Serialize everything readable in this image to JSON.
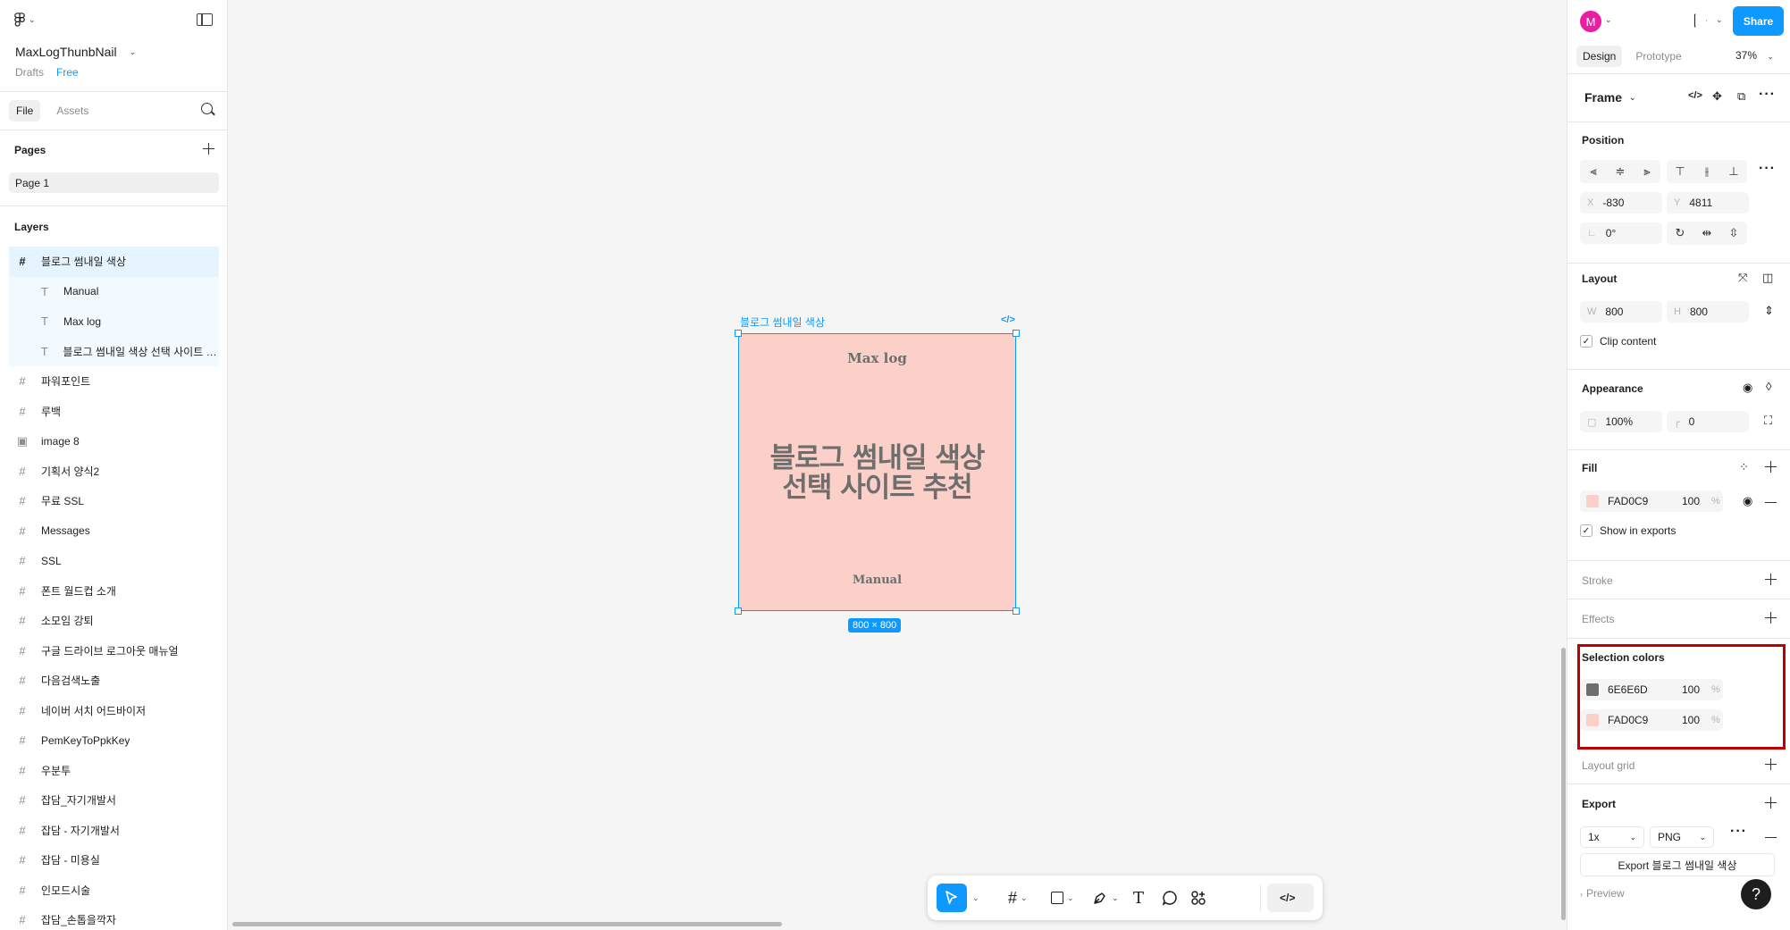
{
  "file": {
    "name": "MaxLogThunbNail",
    "location": "Drafts",
    "plan": "Free"
  },
  "left_tabs": {
    "file": "File",
    "assets": "Assets"
  },
  "pages": {
    "label": "Pages",
    "items": [
      "Page 1"
    ]
  },
  "layers": {
    "label": "Layers",
    "items": [
      {
        "name": "블로그 썸내일 색상",
        "type": "frame",
        "selected": true
      },
      {
        "name": "Manual",
        "type": "text",
        "child": true
      },
      {
        "name": "Max log",
        "type": "text",
        "child": true
      },
      {
        "name": "블로그 썸내일 색상 선택 사이트 추천",
        "type": "text",
        "child": true
      },
      {
        "name": "파워포인트",
        "type": "frame"
      },
      {
        "name": "루백",
        "type": "frame"
      },
      {
        "name": "image 8",
        "type": "image"
      },
      {
        "name": "기획서 양식2",
        "type": "frame"
      },
      {
        "name": "무료 SSL",
        "type": "frame"
      },
      {
        "name": "Messages",
        "type": "frame"
      },
      {
        "name": "SSL",
        "type": "frame"
      },
      {
        "name": "폰트 월드컵 소개",
        "type": "frame"
      },
      {
        "name": "소모임 강퇴",
        "type": "frame"
      },
      {
        "name": "구글 드라이브 로그아웃 매뉴얼",
        "type": "frame"
      },
      {
        "name": "다음검색노출",
        "type": "frame"
      },
      {
        "name": "네이버 서치 어드바이저",
        "type": "frame"
      },
      {
        "name": "PemKeyToPpkKey",
        "type": "frame"
      },
      {
        "name": "우분투",
        "type": "frame"
      },
      {
        "name": "잡담_자기개발서",
        "type": "frame"
      },
      {
        "name": "잡담 - 자기개발서",
        "type": "frame"
      },
      {
        "name": "잡담 - 미용실",
        "type": "frame"
      },
      {
        "name": "인모드시술",
        "type": "frame"
      },
      {
        "name": "잡담_손톱을깍자",
        "type": "frame"
      }
    ]
  },
  "canvas": {
    "frame_label": "블로그 썸내일 색상",
    "frame_code_icon": "</>",
    "frame_top_text": "Max log",
    "frame_main_line1": "블로그 썸내일 색상",
    "frame_main_line2": "선택 사이트 추천",
    "frame_bottom_text": "Manual",
    "size_badge": "800 × 800",
    "frame_fill": "#FAD0C9",
    "text_color": "#6E6E6D"
  },
  "toolbar": {
    "tools": [
      "move-tool",
      "frame-tool",
      "shape-tool",
      "pen-tool",
      "text-tool",
      "comment-tool",
      "actions-tool"
    ],
    "dev_mode_icon": "</>"
  },
  "right": {
    "avatar_letter": "M",
    "share": "Share",
    "tabs": {
      "design": "Design",
      "prototype": "Prototype"
    },
    "zoom": "37%",
    "selection_type": "Frame",
    "position": {
      "label": "Position",
      "x_label": "X",
      "x": "-830",
      "y_label": "Y",
      "y": "4811",
      "rotation": "0°"
    },
    "layout": {
      "label": "Layout",
      "w_label": "W",
      "w": "800",
      "h_label": "H",
      "h": "800",
      "clip_content": "Clip content"
    },
    "appearance": {
      "label": "Appearance",
      "opacity": "100%",
      "radius": "0"
    },
    "fill": {
      "label": "Fill",
      "hex": "FAD0C9",
      "opacity": "100",
      "pct": "%",
      "show_in_exports": "Show in exports",
      "swatch": "#FAD0C9"
    },
    "stroke": {
      "label": "Stroke"
    },
    "effects": {
      "label": "Effects"
    },
    "selection_colors": {
      "label": "Selection colors",
      "items": [
        {
          "hex": "6E6E6D",
          "opacity": "100",
          "pct": "%",
          "swatch": "#6E6E6D"
        },
        {
          "hex": "FAD0C9",
          "opacity": "100",
          "pct": "%",
          "swatch": "#FAD0C9"
        }
      ]
    },
    "layout_grid": {
      "label": "Layout grid"
    },
    "export": {
      "label": "Export",
      "scale": "1x",
      "format": "PNG",
      "button": "Export 블로그 썸내일 색상",
      "preview": "Preview"
    },
    "help": "?"
  }
}
